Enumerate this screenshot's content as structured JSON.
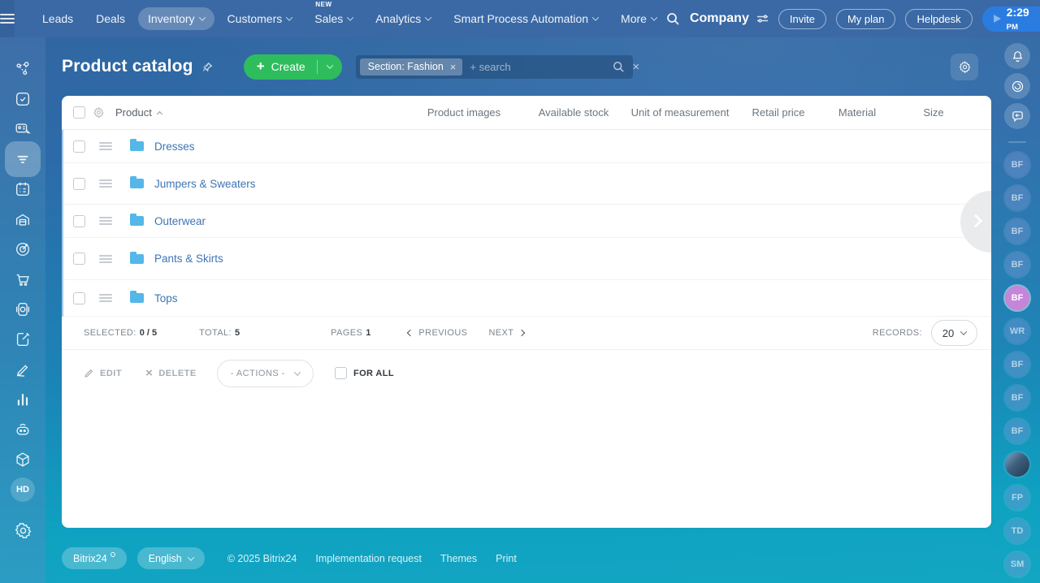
{
  "colors": {
    "topbar_blue": "#3a69a5",
    "background_teal": "#13a6c2",
    "create_green": "#2ebd5d",
    "link_blue": "#3e75b4",
    "folder_blue": "#55b7e9",
    "time_pill_blue": "#2b7ce0",
    "highlight_avatar_purple": "#c585d9"
  },
  "topbar": {
    "nav": [
      {
        "label": "Leads"
      },
      {
        "label": "Deals"
      },
      {
        "label": "Inventory"
      },
      {
        "label": "Customers"
      },
      {
        "label": "Sales",
        "badge": "NEW"
      },
      {
        "label": "Analytics"
      },
      {
        "label": "Smart Process Automation"
      },
      {
        "label": "More"
      }
    ],
    "company_label": "Company",
    "invite_label": "Invite",
    "my_plan_label": "My plan",
    "helpdesk_label": "Helpdesk",
    "clock_time": "2:29",
    "clock_meridiem": "PM"
  },
  "header": {
    "title": "Product catalog",
    "create_label": "Create",
    "filter_chip": "Section: Fashion",
    "search_placeholder": "+ search"
  },
  "grid": {
    "columns": {
      "product": "Product",
      "images": "Product images",
      "stock": "Available stock",
      "unit": "Unit of measurement",
      "price": "Retail price",
      "material": "Material",
      "size": "Size"
    },
    "rows": [
      {
        "name": "Dresses"
      },
      {
        "name": "Jumpers & Sweaters"
      },
      {
        "name": "Outerwear"
      },
      {
        "name": "Pants & Skirts"
      },
      {
        "name": "Tops"
      }
    ]
  },
  "pagination": {
    "selected_label": "SELECTED:",
    "selected_value": "0 / 5",
    "total_label": "TOTAL:",
    "total_value": "5",
    "pages_label": "PAGES",
    "pages_value": "1",
    "previous_label": "PREVIOUS",
    "next_label": "NEXT",
    "records_label": "RECORDS:",
    "records_value": "20"
  },
  "actions": {
    "edit": "EDIT",
    "delete": "DELETE",
    "menu": "- ACTIONS -",
    "for_all": "FOR ALL"
  },
  "footer": {
    "brand": "Bitrix24",
    "language": "English",
    "copyright": "© 2025 Bitrix24",
    "links": [
      "Implementation request",
      "Themes",
      "Print"
    ]
  },
  "left_rail": {
    "hd_badge": "HD"
  },
  "right_rail": {
    "avatars": [
      {
        "initials": "BF"
      },
      {
        "initials": "BF"
      },
      {
        "initials": "BF"
      },
      {
        "initials": "BF"
      },
      {
        "initials": "BF"
      },
      {
        "initials": "WR"
      },
      {
        "initials": "BF"
      },
      {
        "initials": "BF"
      },
      {
        "initials": "BF"
      },
      {
        "initials": ""
      },
      {
        "initials": "FP"
      },
      {
        "initials": "TD"
      },
      {
        "initials": "SM"
      }
    ]
  }
}
